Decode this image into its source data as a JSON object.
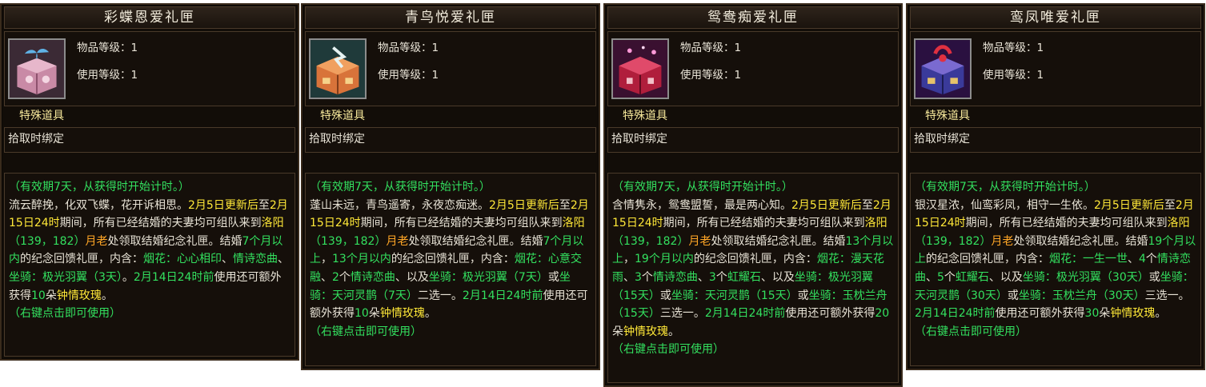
{
  "labels": {
    "item_level": "物品等级：1",
    "use_level": "使用等级：1",
    "special_item": "特殊道具",
    "bind_on_pickup": "拾取时绑定",
    "validity": "（有效期7天，从获得时开始计时。）",
    "right_click": "（右键点击即可使用）"
  },
  "colors": {
    "green": "#33e05f",
    "yellow": "#ffe838",
    "orange": "#ffa626",
    "white": "#e8e3d6"
  },
  "tooltips": [
    {
      "title": "彩蝶恩爱礼匣",
      "icon": "pink-gift-box-icon",
      "segments": [
        [
          "w",
          "流云醉挽，化双飞蝶，花开诉相思。"
        ],
        [
          "y",
          "2月5日更新后"
        ],
        [
          "w",
          "至"
        ],
        [
          "y",
          "2月15日24时"
        ],
        [
          "w",
          "期间，所有已经结婚的夫妻均可组队来到"
        ],
        [
          "y",
          "洛阳"
        ],
        [
          "g",
          "（139，182）"
        ],
        [
          "o",
          "月老"
        ],
        [
          "w",
          "处领取结婚纪念礼匣。结婚"
        ],
        [
          "g",
          "7个月以内"
        ],
        [
          "w",
          "的纪念回馈礼匣，内含："
        ],
        [
          "g",
          "烟花：心心相印"
        ],
        [
          "w",
          "、"
        ],
        [
          "g",
          "情诗恋曲"
        ],
        [
          "w",
          "、"
        ],
        [
          "g",
          "坐骑：极光羽翼（3天）"
        ],
        [
          "w",
          "。"
        ],
        [
          "g",
          "2月14日24时前"
        ],
        [
          "w",
          "使用还可额外获得"
        ],
        [
          "g",
          "10"
        ],
        [
          "w",
          "朵"
        ],
        [
          "y",
          "钟情玫瑰"
        ],
        [
          "w",
          "。"
        ]
      ]
    },
    {
      "title": "青鸟悦爱礼匣",
      "icon": "orange-gift-box-icon",
      "segments": [
        [
          "w",
          "蓬山未远，青鸟遥寄，永夜恋痴迷。"
        ],
        [
          "y",
          "2月5日更新后"
        ],
        [
          "w",
          "至"
        ],
        [
          "y",
          "2月15日24时"
        ],
        [
          "w",
          "期间，所有已经结婚的夫妻均可组队来到"
        ],
        [
          "y",
          "洛阳"
        ],
        [
          "g",
          "（139，182）"
        ],
        [
          "o",
          "月老"
        ],
        [
          "w",
          "处领取结婚纪念礼匣。结婚"
        ],
        [
          "g",
          "7个月以上"
        ],
        [
          "w",
          "，"
        ],
        [
          "g",
          "13个月以内"
        ],
        [
          "w",
          "的纪念回馈礼匣，内含："
        ],
        [
          "g",
          "烟花：心意交融"
        ],
        [
          "w",
          "、"
        ],
        [
          "g",
          "2"
        ],
        [
          "w",
          "个"
        ],
        [
          "g",
          "情诗恋曲"
        ],
        [
          "w",
          "、以及"
        ],
        [
          "g",
          "坐骑：极光羽翼（7天）"
        ],
        [
          "w",
          "或"
        ],
        [
          "g",
          "坐骑：天河灵鹊（7天）"
        ],
        [
          "w",
          "二选一。"
        ],
        [
          "g",
          "2月14日24时前"
        ],
        [
          "w",
          "使用还可额外获得"
        ],
        [
          "g",
          "10"
        ],
        [
          "w",
          "朵"
        ],
        [
          "y",
          "钟情玫瑰"
        ],
        [
          "w",
          "。"
        ]
      ]
    },
    {
      "title": "鸳鸯痴爱礼匣",
      "icon": "red-gift-box-icon",
      "segments": [
        [
          "w",
          "含情隽永，鸳鸯盟誓，最是两心知。"
        ],
        [
          "y",
          "2月5日更新后"
        ],
        [
          "w",
          "至"
        ],
        [
          "y",
          "2月15日24时"
        ],
        [
          "w",
          "期间，所有已经结婚的夫妻均可组队来到"
        ],
        [
          "y",
          "洛阳"
        ],
        [
          "g",
          "（139，182）"
        ],
        [
          "o",
          "月老"
        ],
        [
          "w",
          "处领取结婚纪念礼匣。结婚"
        ],
        [
          "g",
          "13个月以上"
        ],
        [
          "w",
          "，"
        ],
        [
          "g",
          "19个月以内"
        ],
        [
          "w",
          "的纪念回馈礼匣，内含："
        ],
        [
          "g",
          "烟花：漫天花雨"
        ],
        [
          "w",
          "、"
        ],
        [
          "g",
          "3"
        ],
        [
          "w",
          "个"
        ],
        [
          "g",
          "情诗恋曲"
        ],
        [
          "w",
          "、"
        ],
        [
          "g",
          "3"
        ],
        [
          "w",
          "个"
        ],
        [
          "g",
          "虹耀石"
        ],
        [
          "w",
          "、以及"
        ],
        [
          "g",
          "坐骑：极光羽翼（15天）"
        ],
        [
          "w",
          "或"
        ],
        [
          "g",
          "坐骑：天河灵鹊（15天）"
        ],
        [
          "w",
          "或"
        ],
        [
          "g",
          "坐骑：玉枕兰舟（15天）"
        ],
        [
          "w",
          "三选一。"
        ],
        [
          "g",
          "2月14日24时前"
        ],
        [
          "w",
          "使用还可额外获得"
        ],
        [
          "g",
          "20"
        ],
        [
          "w",
          "朵"
        ],
        [
          "y",
          "钟情玫瑰"
        ],
        [
          "w",
          "。"
        ]
      ]
    },
    {
      "title": "鸾凤唯爱礼匣",
      "icon": "purple-gift-box-icon",
      "segments": [
        [
          "w",
          "银汉星浓，仙鸾彩凤，相守一生依。"
        ],
        [
          "y",
          "2月5日更新后"
        ],
        [
          "w",
          "至"
        ],
        [
          "y",
          "2月15日24时"
        ],
        [
          "w",
          "期间，所有已经结婚的夫妻均可组队来到"
        ],
        [
          "y",
          "洛阳"
        ],
        [
          "g",
          "（139，182）"
        ],
        [
          "o",
          "月老"
        ],
        [
          "w",
          "处领取结婚纪念礼匣。结婚"
        ],
        [
          "g",
          "19个月以上"
        ],
        [
          "w",
          "的纪念回馈礼匣，内含："
        ],
        [
          "g",
          "烟花：一生一世"
        ],
        [
          "w",
          "、"
        ],
        [
          "g",
          "4"
        ],
        [
          "w",
          "个"
        ],
        [
          "g",
          "情诗恋曲"
        ],
        [
          "w",
          "、"
        ],
        [
          "g",
          "5"
        ],
        [
          "w",
          "个"
        ],
        [
          "g",
          "虹耀石"
        ],
        [
          "w",
          "、以及"
        ],
        [
          "g",
          "坐骑：极光羽翼（30天）"
        ],
        [
          "w",
          "或"
        ],
        [
          "g",
          "坐骑：天河灵鹊（30天）"
        ],
        [
          "w",
          "或"
        ],
        [
          "g",
          "坐骑：玉枕兰舟（30天）"
        ],
        [
          "w",
          "三选一。"
        ],
        [
          "g",
          "2月14日24时前"
        ],
        [
          "w",
          "使用还可额外获得"
        ],
        [
          "g",
          "30"
        ],
        [
          "w",
          "朵"
        ],
        [
          "y",
          "钟情玫瑰"
        ],
        [
          "w",
          "。"
        ]
      ]
    }
  ]
}
